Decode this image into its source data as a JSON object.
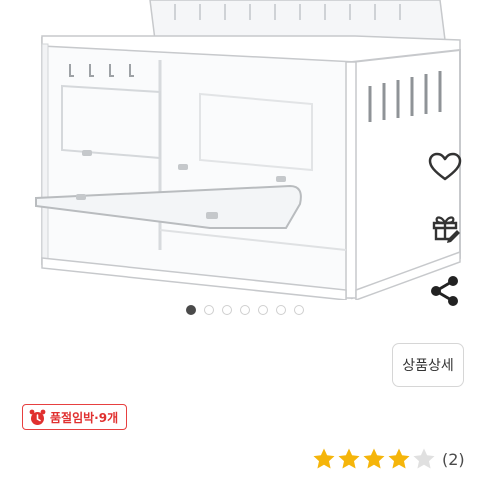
{
  "product": {
    "image_alt": "acrylic display cage"
  },
  "actions": {
    "like_icon": "heart-icon",
    "gift_icon": "gift-icon",
    "share_icon": "share-icon"
  },
  "carousel": {
    "total": 7,
    "current": 1
  },
  "detail_button": {
    "label": "상품상세"
  },
  "badge": {
    "icon": "alarm-clock-icon",
    "label": "품절임박·9개",
    "color": "#e0302f"
  },
  "rating": {
    "value": 4,
    "max": 5,
    "count_label": "(2)",
    "star_color": "#f5b50a",
    "empty_color": "#e0e0e0"
  }
}
